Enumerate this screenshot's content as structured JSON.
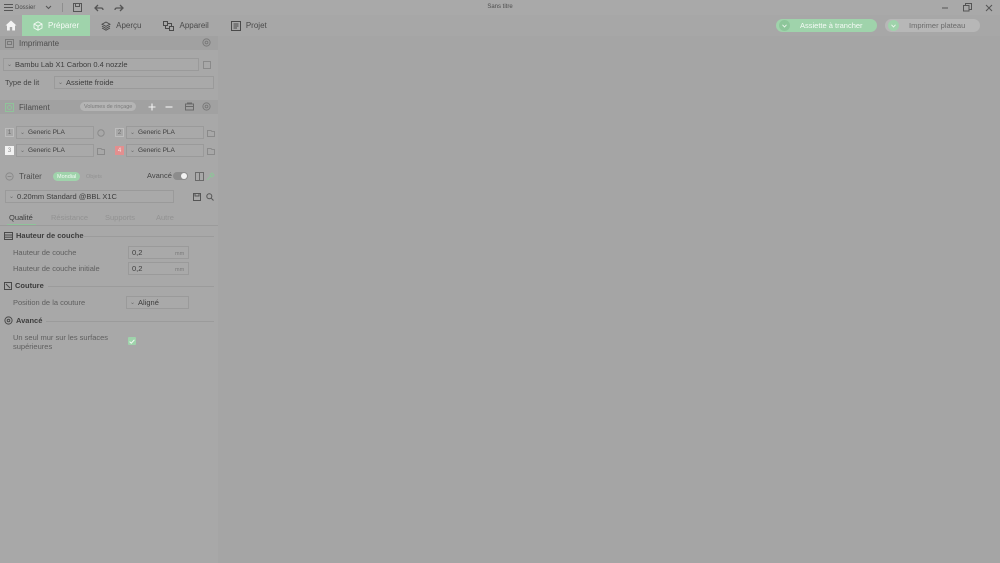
{
  "app": {
    "window_title": "Sans titre"
  },
  "titlebar": {
    "menu_label": "Dossier"
  },
  "toolbar": {
    "tabs": [
      {
        "label": "Préparer",
        "icon": "cube-icon",
        "active": true
      },
      {
        "label": "Aperçu",
        "icon": "layers-icon",
        "active": false
      },
      {
        "label": "Appareil",
        "icon": "device-icon",
        "active": false
      },
      {
        "label": "Projet",
        "icon": "project-icon",
        "active": false
      }
    ],
    "slice_button": "Assiette à trancher",
    "print_button": "Imprimer plateau"
  },
  "printer": {
    "header": "Imprimante",
    "printer_value": "Bambu Lab X1 Carbon 0.4 nozzle",
    "bed_label": "Type de lit",
    "bed_value": "Assiette froide"
  },
  "filament": {
    "header": "Filament",
    "rinse_button": "Volumes de rinçage",
    "slots": [
      {
        "num": "1",
        "name": "Generic PLA",
        "color": "#a8a8a8"
      },
      {
        "num": "2",
        "name": "Generic PLA",
        "color": "#a8a8a8"
      },
      {
        "num": "3",
        "name": "Generic PLA",
        "color": "#f2f2f2"
      },
      {
        "num": "4",
        "name": "Generic PLA",
        "color": "#e38f8f"
      }
    ]
  },
  "process": {
    "header": "Traiter",
    "mode_global": "Mondial",
    "mode_objects": "Objets",
    "advanced_label": "Avancé",
    "preset": "0.20mm Standard @BBL X1C",
    "tabs": [
      "Qualité",
      "Résistance",
      "Supports",
      "Autre"
    ]
  },
  "quality": {
    "layer_group": "Hauteur de couche",
    "layer_height_label": "Hauteur de couche",
    "layer_height_value": "0,2",
    "initial_layer_label": "Hauteur de couche initiale",
    "initial_layer_value": "0,2",
    "unit": "mm",
    "seam_group": "Couture",
    "seam_position_label": "Position de la couture",
    "seam_position_value": "Aligné",
    "advanced_group": "Avancé",
    "single_wall_label_1": "Un seul mur sur les surfaces",
    "single_wall_label_2": "supérieures",
    "single_wall_checked": true
  },
  "colors": {
    "accent": "#9fd3ab",
    "panel": "#a8a8a8",
    "background": "#a5a5a5"
  }
}
